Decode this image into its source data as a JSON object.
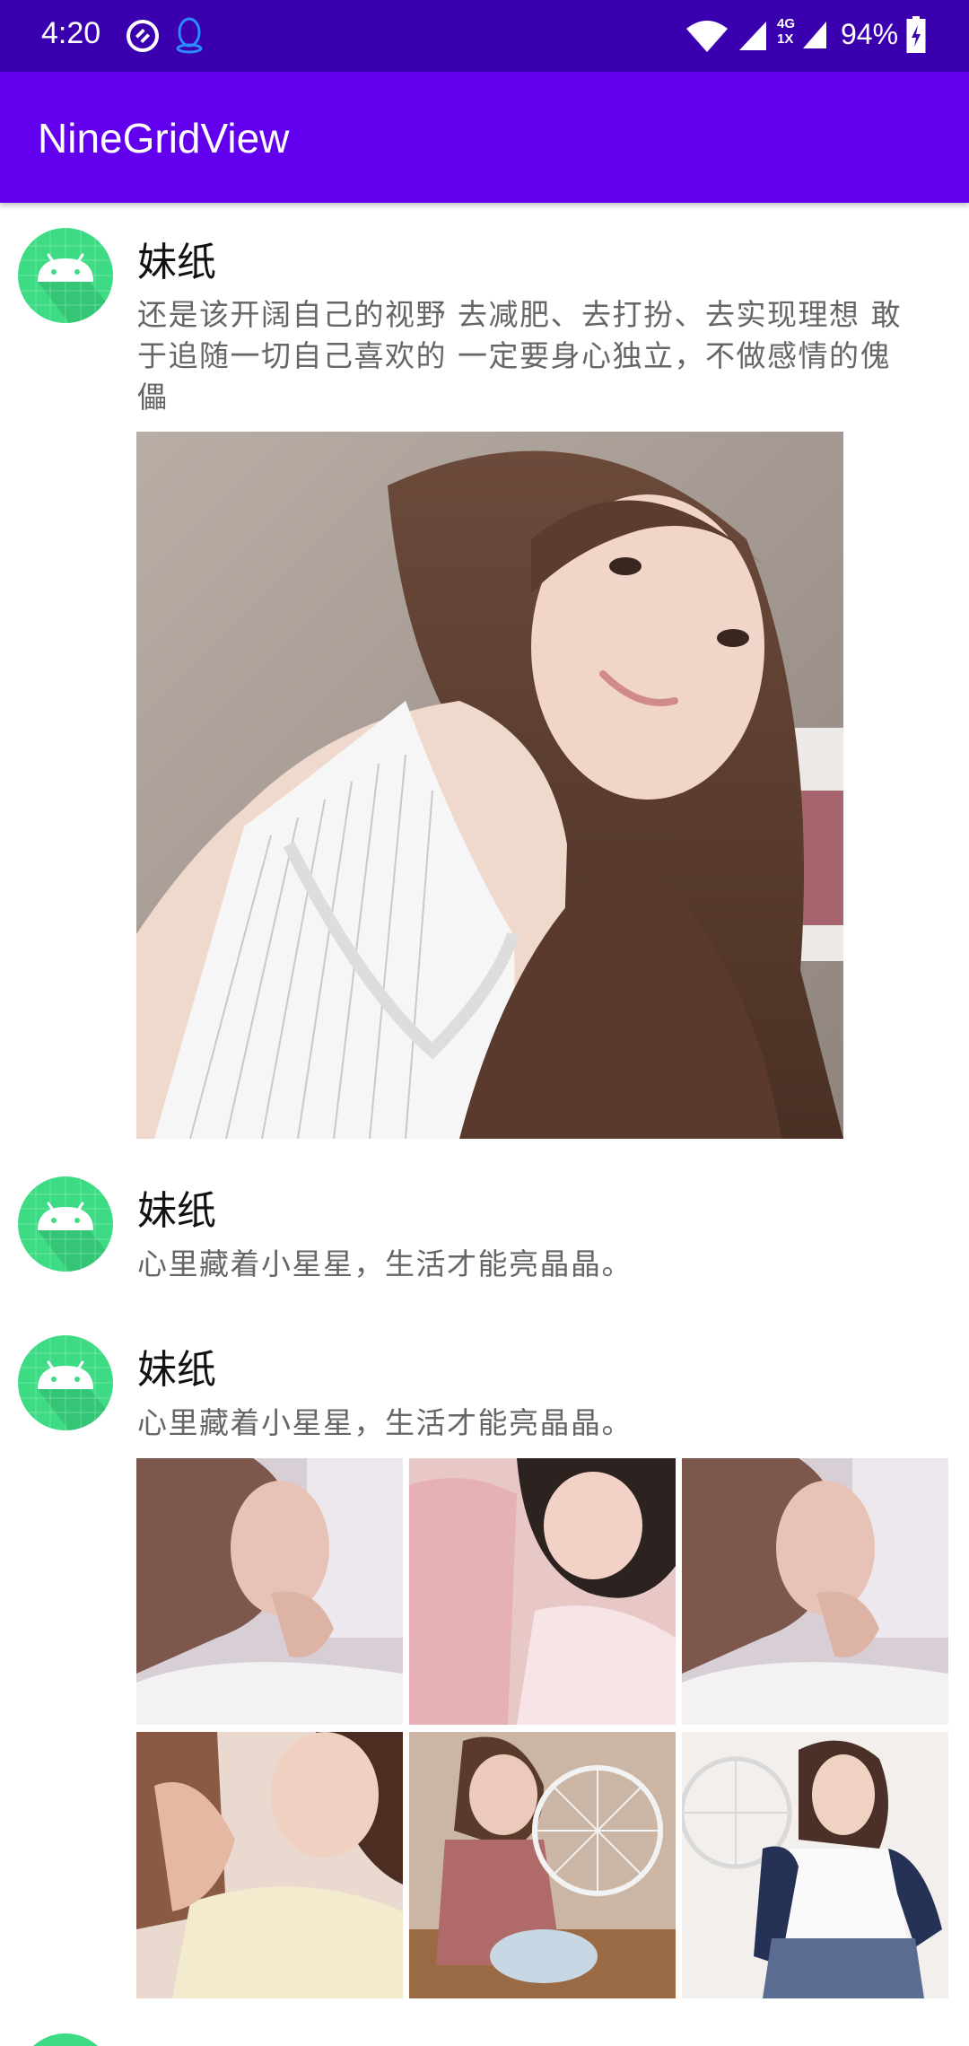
{
  "status_bar": {
    "time": "4:20",
    "network_label_top": "4G",
    "network_label_bottom": "1X",
    "battery": "94%",
    "icons": [
      "vpn-icon",
      "qq-icon",
      "wifi-icon",
      "signal-icon",
      "signal-icon-2",
      "battery-icon"
    ]
  },
  "app_bar": {
    "title": "NineGridView",
    "color": "#6200ee"
  },
  "posts": [
    {
      "name": "妹纸",
      "content_line1": "还是该开阔自己的视野 去减肥、去打扮、去实现理想 敢",
      "content_line2": "于追随一切自己喜欢的 一定要身心独立，不做感情的傀",
      "content_line3": "儡",
      "images": [
        "photo-selfie"
      ]
    },
    {
      "name": "妹纸",
      "content": "心里藏着小星星，生活才能亮晶晶。",
      "images": []
    },
    {
      "name": "妹纸",
      "content": "心里藏着小星星，生活才能亮晶晶。",
      "images": [
        "photo-1",
        "photo-2",
        "photo-3",
        "photo-4",
        "photo-5",
        "photo-6"
      ]
    }
  ],
  "colors": {
    "status_bar": "#3a00b0",
    "app_bar": "#6200ee",
    "avatar_bg": "#3ddc84"
  }
}
